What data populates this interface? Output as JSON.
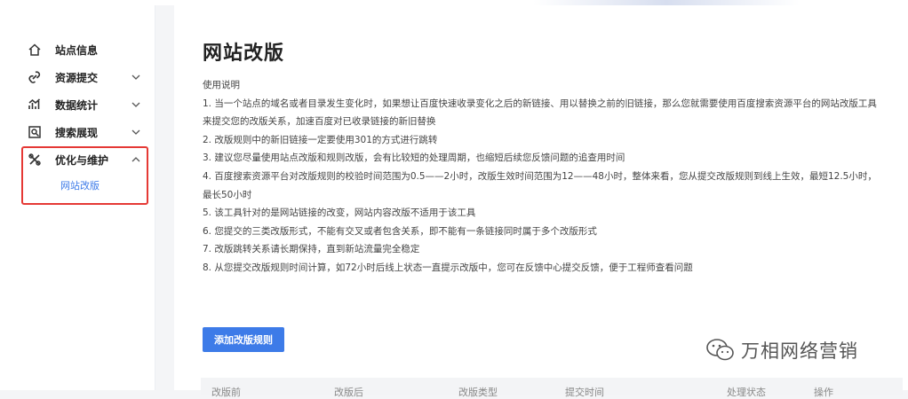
{
  "sidebar": {
    "items": [
      {
        "label": "站点信息",
        "icon": "home-icon",
        "chevron": ""
      },
      {
        "label": "资源提交",
        "icon": "link-icon",
        "chevron": "down"
      },
      {
        "label": "数据统计",
        "icon": "chart-icon",
        "chevron": "down"
      },
      {
        "label": "搜索展现",
        "icon": "search-doc-icon",
        "chevron": "down"
      },
      {
        "label": "优化与维护",
        "icon": "tools-icon",
        "chevron": "up"
      }
    ],
    "sub_item": "网站改版",
    "highlight_color": "#e53935",
    "active_color": "#3d7be8"
  },
  "main": {
    "title": "网站改版",
    "instructions_heading": "使用说明",
    "instructions": [
      "1. 当一个站点的域名或者目录发生变化时，如果想让百度快速收录变化之后的新链接、用以替换之前的旧链接，那么您就需要使用百度搜索资源平台的网站改版工具来提交您的改版关系，加速百度对已收录链接的新旧替换",
      "2. 改版规则中的新旧链接一定要使用301的方式进行跳转",
      "3. 建议您尽量使用站点改版和规则改版，会有比较短的处理周期，也缩短后续您反馈问题的追查用时间",
      "4. 百度搜索资源平台对改版规则的校验时间范围为0.5——2小时，改版生效时间范围为12——48小时，整体来看，您从提交改版规则到线上生效，最短12.5小时，最长50小时",
      "5. 该工具针对的是网站链接的改变，网站内容改版不适用于该工具",
      "6. 您提交的三类改版形式，不能有交叉或者包含关系，即不能有一条链接同时属于多个改版形式",
      "7. 改版跳转关系请长期保持，直到新站流量完全稳定",
      "8. 从您提交改版规则时间计算，如72小时后线上状态一直提示改版中，您可在反馈中心提交反馈，便于工程师查看问题"
    ],
    "add_button": "添加改版规则",
    "table_headers": [
      "改版前",
      "改版后",
      "改版类型",
      "提交时间",
      "处理状态",
      "操作"
    ]
  },
  "watermark": {
    "text": "万相网络营销",
    "icon": "wechat-icon"
  }
}
